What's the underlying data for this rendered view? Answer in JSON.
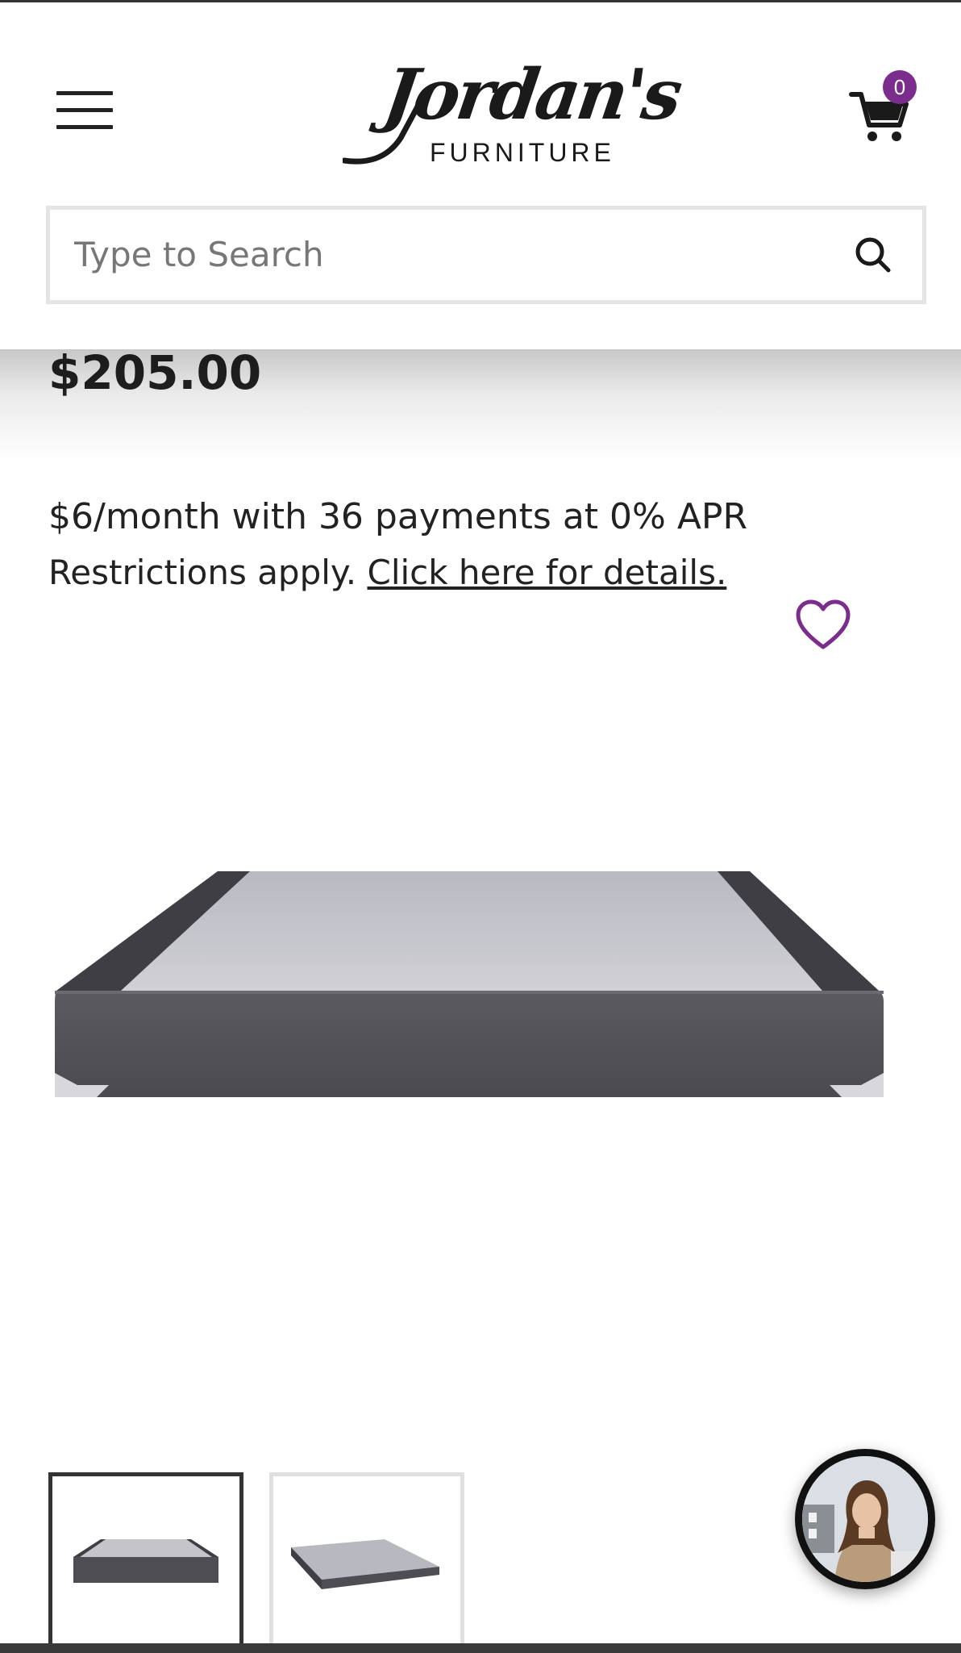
{
  "header": {
    "logo_script": "Jordan's",
    "logo_sub": "FURNITURE",
    "cart_count": "0",
    "menu_icon": "hamburger-menu-icon",
    "cart_icon": "shopping-cart-icon"
  },
  "search": {
    "placeholder": "Type to Search",
    "icon": "search-icon"
  },
  "product": {
    "price": "$205.00",
    "finance_main": "$6/month with 36 payments at 0% APR",
    "finance_restrictions": "Restrictions apply. ",
    "finance_link": "Click here for details.",
    "wishlist_icon": "heart-icon"
  },
  "gallery": {
    "thumbnails": [
      "box-spring-front-view",
      "box-spring-angled-view"
    ],
    "active_index": 0
  },
  "chat": {
    "icon": "chat-agent-avatar"
  },
  "colors": {
    "accent": "#7b2d8e",
    "text": "#222222",
    "search_border": "#e4e4e4"
  }
}
